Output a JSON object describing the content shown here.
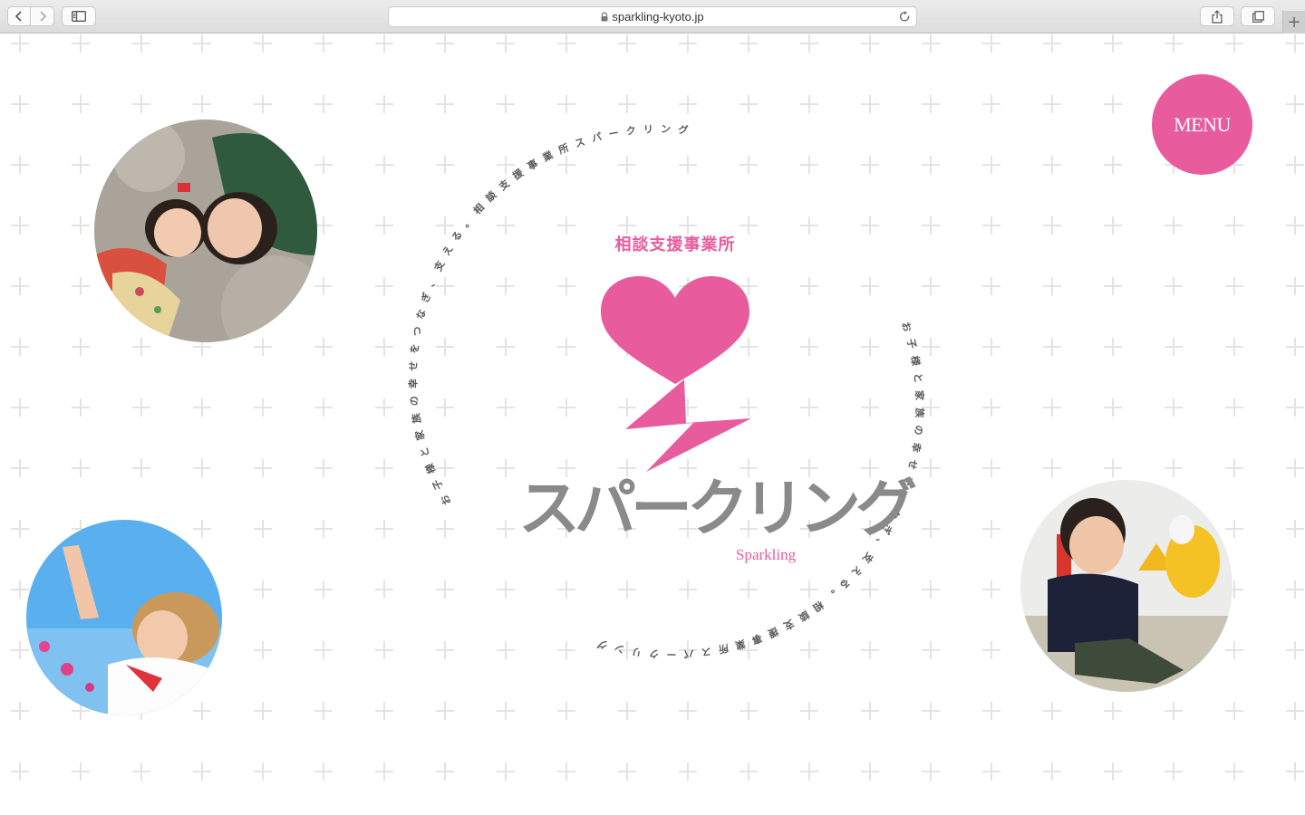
{
  "browser": {
    "url": "sparkling-kyoto.jp",
    "new_tab_glyph": "+"
  },
  "header": {
    "menu_label": "MENU"
  },
  "logo": {
    "subtitle": "相談支援事業所",
    "kana": "スパークリング",
    "english": "Sparkling",
    "ring_text_top": "お子様と家族の幸せをつなぎ、支える。相談支援事業所スパークリング",
    "ring_text_bottom": "お子様と家族の幸せをつなぎ、支える。相談支援事業所スパークリング"
  },
  "colors": {
    "accent": "#e85c9e",
    "logo_gray": "#8a8a8a",
    "grid": "#e3e3e3"
  }
}
